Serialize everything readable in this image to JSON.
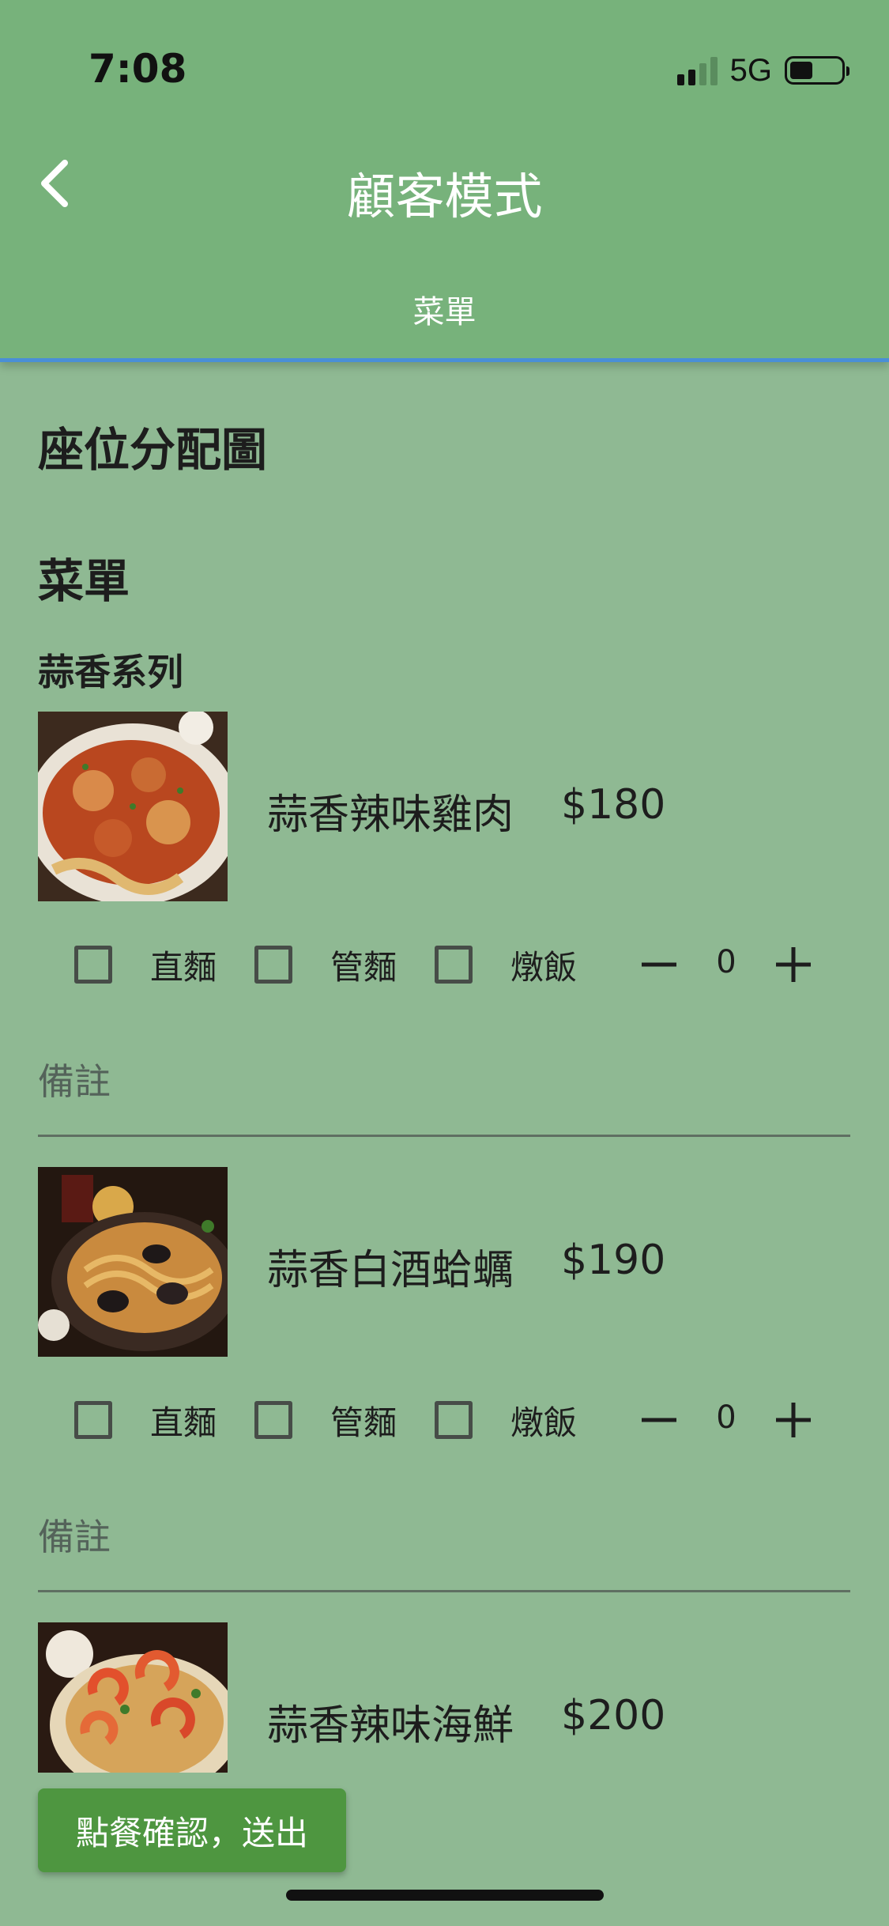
{
  "status_bar": {
    "time": "7:08",
    "network": "5G",
    "icons": [
      "signal-icon",
      "battery-icon"
    ]
  },
  "header": {
    "back_icon": "chevron-left-icon",
    "title": "顧客模式",
    "tab": "菜單"
  },
  "sections": {
    "seating_heading": "座位分配圖",
    "menu_heading": "菜單",
    "category_heading": "蒜香系列"
  },
  "menu_items": [
    {
      "name": "蒜香辣味雞肉",
      "price": "$180",
      "options": [
        "直麵",
        "管麵",
        "燉飯"
      ],
      "quantity": "0",
      "note_placeholder": "備註"
    },
    {
      "name": "蒜香白酒蛤蠣",
      "price": "$190",
      "options": [
        "直麵",
        "管麵",
        "燉飯"
      ],
      "quantity": "0",
      "note_placeholder": "備註"
    },
    {
      "name": "蒜香辣味海鮮",
      "price": "$200"
    }
  ],
  "actions": {
    "submit_label": "點餐確認，送出"
  },
  "colors": {
    "app_bar": "#77b27b",
    "background": "#8fb993",
    "accent_line": "#4a8fd6",
    "submit_button": "#4e9640"
  }
}
